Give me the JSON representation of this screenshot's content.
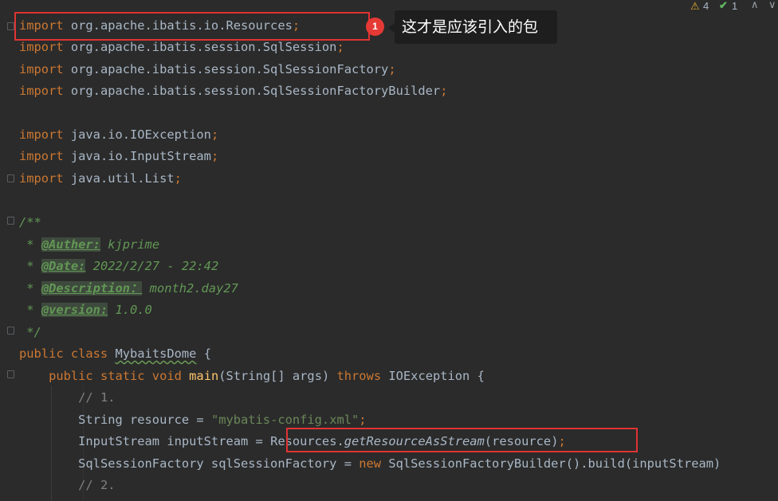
{
  "status": {
    "warnings": "4",
    "checks": "1",
    "warn_icon": "⚠",
    "check_icon": "✔",
    "up_icon": "∧",
    "down_icon": "∨"
  },
  "annotation": {
    "badge": "1",
    "tooltip": "这才是应该引入的包"
  },
  "code": {
    "l1": {
      "kw": "import",
      "rest": " org.apache.ibatis.io.Resources",
      "semi": ";"
    },
    "l2": {
      "kw": "import",
      "rest": " org.apache.ibatis.session.SqlSession",
      "semi": ";"
    },
    "l3": {
      "kw": "import",
      "rest": " org.apache.ibatis.session.SqlSessionFactory",
      "semi": ";"
    },
    "l4": {
      "kw": "import",
      "rest": " org.apache.ibatis.session.SqlSessionFactoryBuilder",
      "semi": ";"
    },
    "l5": {
      "kw": "import",
      "rest": " java.io.IOException",
      "semi": ";"
    },
    "l6": {
      "kw": "import",
      "rest": " java.io.InputStream",
      "semi": ";"
    },
    "l7": {
      "kw": "import",
      "rest": " java.util.List",
      "semi": ";"
    },
    "l8": {
      "text": "/**"
    },
    "l9": {
      "star": " * ",
      "tag": "@Auther:",
      "val": " kjprime"
    },
    "l10": {
      "star": " * ",
      "tag": "@Date:",
      "val": " 2022/2/27 - 22:42"
    },
    "l11": {
      "star": " * ",
      "tag": "@Description：",
      "val": " month2.day27"
    },
    "l12": {
      "star": " * ",
      "tag": "@version:",
      "val": " 1.0.0"
    },
    "l13": {
      "text": " */"
    },
    "l14": {
      "kw": "public class",
      "sp": " ",
      "name": "MybaitsDome",
      "rest": " {"
    },
    "l15": {
      "indent": "    ",
      "kw": "public static void",
      "sp": " ",
      "name": "main",
      "p1": "(String[] args) ",
      "kw2": "throws",
      "p2": " IOException {"
    },
    "l16": {
      "indent": "        ",
      "text": "// 1."
    },
    "l17": {
      "indent": "        ",
      "pre": "String resource = ",
      "str": "\"mybatis-config.xml\"",
      "semi": ";"
    },
    "l18": {
      "indent": "        ",
      "pre": "InputStream inputStream = ",
      "cls": "Resources.",
      "method": "getResourceAsStream",
      "args": "(resource)",
      "semi": ";"
    },
    "l19": {
      "indent": "        ",
      "pre": "SqlSessionFactory sqlSessionFactory = ",
      "kw": "new",
      "rest": " SqlSessionFactoryBuilder().build(inputStream)"
    },
    "l20": {
      "indent": "        ",
      "text": "// 2."
    }
  }
}
